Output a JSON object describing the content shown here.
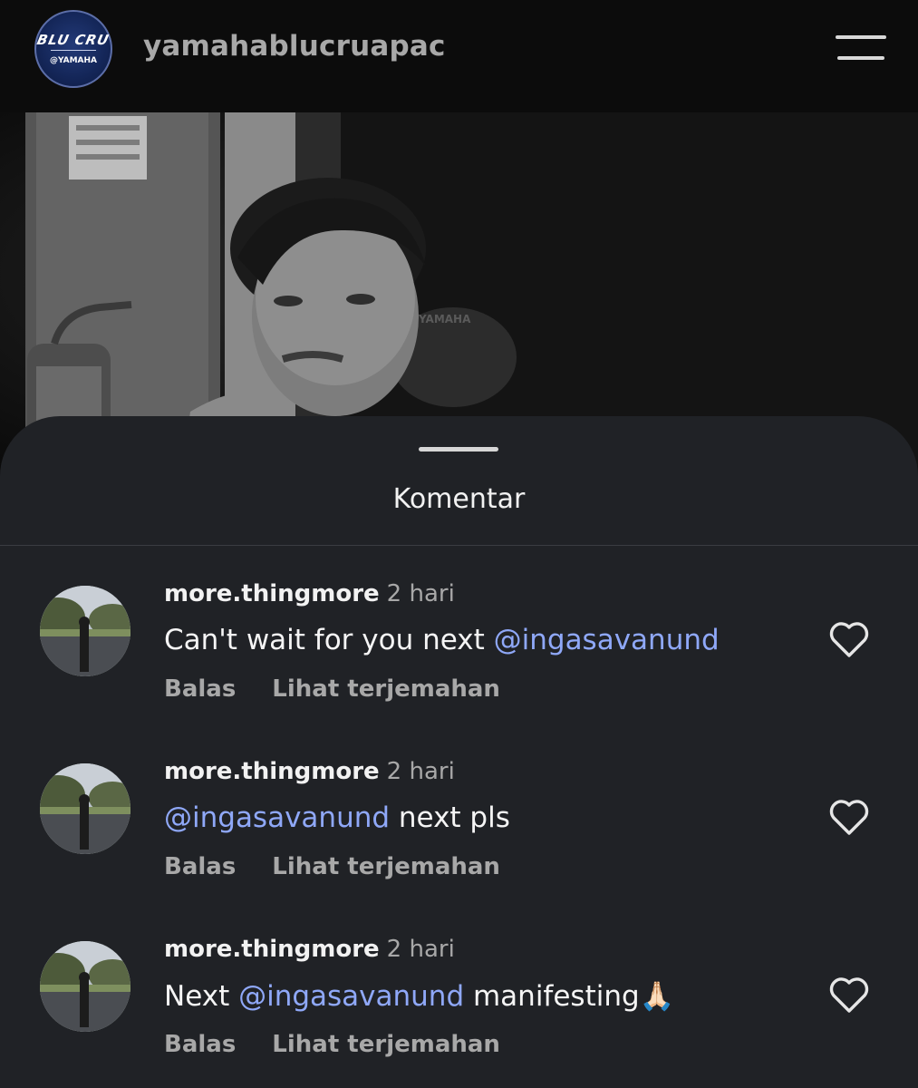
{
  "header": {
    "username": "yamahablucruapac",
    "logo": {
      "line1": "BLU CRU",
      "line2": "@YAMAHA",
      "brand_color": "#142658"
    },
    "menu_icon": "hamburger-icon"
  },
  "sheet": {
    "title": "Komentar"
  },
  "comments": [
    {
      "user": "more.thingmore",
      "time": "2 hari",
      "text_before": "Can't wait for you next ",
      "mention": "@ingasavanund",
      "text_after": "",
      "reply_label": "Balas",
      "translate_label": "Lihat terjemahan"
    },
    {
      "user": "more.thingmore",
      "time": "2 hari",
      "text_before": "",
      "mention": "@ingasavanund",
      "text_after": " next pls",
      "reply_label": "Balas",
      "translate_label": "Lihat terjemahan"
    },
    {
      "user": "more.thingmore",
      "time": "2 hari",
      "text_before": "Next ",
      "mention": "@ingasavanund",
      "text_after": " manifesting🙏🏻",
      "reply_label": "Balas",
      "translate_label": "Lihat terjemahan"
    }
  ],
  "colors": {
    "background": "#0c0c0c",
    "sheet": "#202226",
    "mention": "#8fa8f8",
    "muted": "#a8a8a8"
  }
}
